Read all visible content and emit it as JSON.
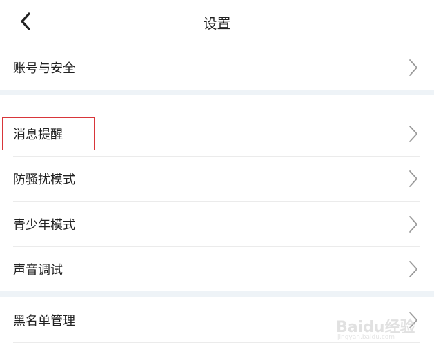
{
  "header": {
    "title": "设置",
    "back_icon": "chevron-left-icon"
  },
  "settings": {
    "items": [
      {
        "label": "账号与安全"
      },
      {
        "label": "消息提醒"
      },
      {
        "label": "防骚扰模式"
      },
      {
        "label": "青少年模式"
      },
      {
        "label": "声音调试"
      },
      {
        "label": "黑名单管理"
      }
    ]
  },
  "watermark": {
    "text": "Baidu经验",
    "sub": "jingyan.baidu.com"
  },
  "colors": {
    "highlight": "#d8363a",
    "section_gap": "#eef3f7",
    "divider": "#ebebeb"
  }
}
